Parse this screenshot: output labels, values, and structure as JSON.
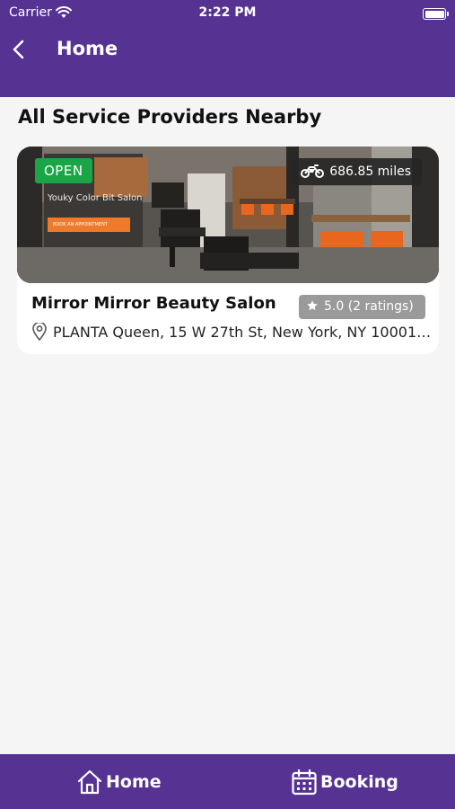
{
  "status_bar": {
    "carrier": "Carrier",
    "time": "2:22 PM"
  },
  "nav": {
    "title": "Home",
    "back_icon": "chevron-left-icon"
  },
  "section": {
    "title": "All Service Providers Nearby"
  },
  "providers": [
    {
      "status": "OPEN",
      "distance": "686.85 miles",
      "photo_sign": "Youky Color Bit Salon",
      "photo_cta": "BOOK AN APPOINTMENT",
      "name": "Mirror Mirror Beauty Salon",
      "rating": "5.0 (2 ratings)",
      "address": "PLANTA Queen, 15 W 27th St, New York, NY 10001, USA"
    }
  ],
  "tabbar": {
    "items": [
      {
        "label": "Home",
        "icon": "house-icon"
      },
      {
        "label": "Booking",
        "icon": "calendar-icon"
      }
    ]
  },
  "colors": {
    "primary": "#563293",
    "open": "#1aa547",
    "rating_bg": "#9a9a9a",
    "background": "#f5f5f5"
  }
}
